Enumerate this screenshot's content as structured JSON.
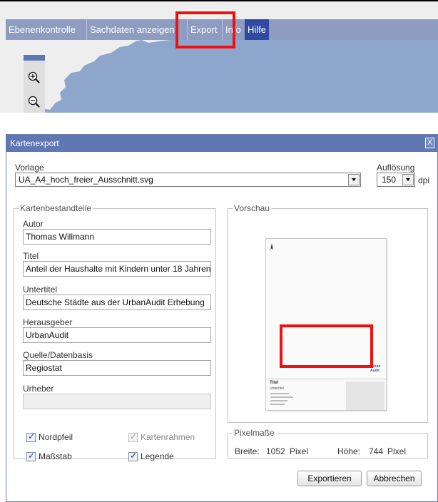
{
  "menu": {
    "items": [
      {
        "label": "Ebenenkontrolle",
        "active": false
      },
      {
        "label": "Sachdaten anzeigen",
        "active": false
      },
      {
        "label": "Export",
        "active": false
      },
      {
        "label": "Info",
        "active": false
      },
      {
        "label": "Hilfe",
        "active": true
      }
    ]
  },
  "map": {
    "zoom_in_icon": "zoom-in-magnifier",
    "zoom_out_icon": "zoom-out-magnifier",
    "colors": {
      "water": "#8ea6cc",
      "land": "#eeeeee",
      "menu": "#8d9cc0",
      "highlight": "#ee1111"
    }
  },
  "dialog": {
    "title": "Kartenexport",
    "close_label": "X",
    "template": {
      "label": "Vorlage",
      "value": "UA_A4_hoch_freier_Ausschnitt.svg"
    },
    "resolution": {
      "label": "Auflösung",
      "value": "150",
      "unit": "dpi"
    },
    "components": {
      "legend": "Kartenbestandteile",
      "fields": [
        {
          "label": "Autor",
          "value": "Thomas Willmann",
          "disabled": false
        },
        {
          "label": "Titel",
          "value": "Anteil der Haushalte mit Kindern unter 18 Jahren",
          "disabled": false
        },
        {
          "label": "Untertitel",
          "value": "Deutsche Städte aus der UrbanAudit Erhebung",
          "disabled": false
        },
        {
          "label": "Herausgeber",
          "value": "UrbanAudit",
          "disabled": false
        },
        {
          "label": "Quelle/Datenbasis",
          "value": "Regiostat",
          "disabled": false
        },
        {
          "label": "Urheber",
          "value": "",
          "disabled": true
        }
      ],
      "checkboxes": [
        {
          "label": "Nordpfeil",
          "checked": true,
          "disabled": false
        },
        {
          "label": "Kartenrahmen",
          "checked": true,
          "disabled": true
        },
        {
          "label": "Maßstab",
          "checked": true,
          "disabled": false
        },
        {
          "label": "Legende",
          "checked": true,
          "disabled": false
        }
      ]
    },
    "preview": {
      "legend": "Vorschau",
      "paper": {
        "title": "Titel",
        "subtitle": "Untertitel",
        "logo": "Urban Audit"
      }
    },
    "pixel": {
      "legend": "Pixelmaße",
      "width_label": "Breite:",
      "width_value": "1052",
      "height_label": "Höhe:",
      "height_value": "744",
      "unit": "Pixel"
    },
    "buttons": {
      "export": "Exportieren",
      "cancel": "Abbrechen"
    }
  }
}
